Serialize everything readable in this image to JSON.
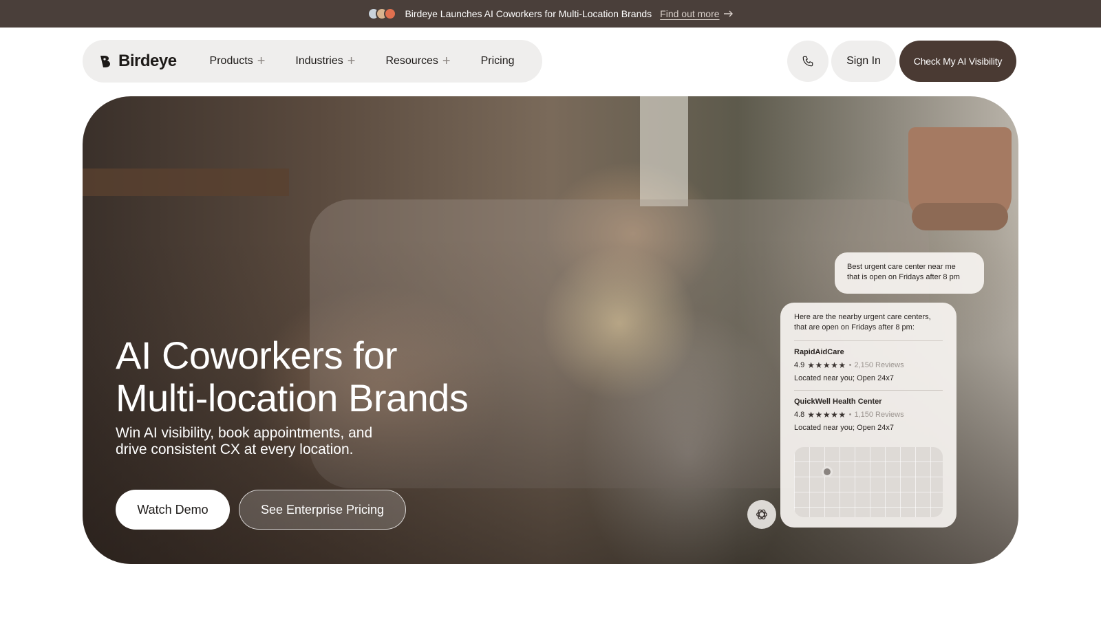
{
  "announcement": {
    "text": "Birdeye Launches AI Coworkers for Multi-Location Brands",
    "link_label": "Find out more"
  },
  "header": {
    "logo_text": "Birdeye",
    "nav": [
      {
        "label": "Products",
        "has_menu": true
      },
      {
        "label": "Industries",
        "has_menu": true
      },
      {
        "label": "Resources",
        "has_menu": true
      },
      {
        "label": "Pricing",
        "has_menu": false
      }
    ],
    "signin_label": "Sign In",
    "cta_label": "Check My AI Visibility"
  },
  "hero": {
    "title_line1": "AI Coworkers for",
    "title_line2": "Multi-location Brands",
    "subtitle_line1": "Win AI visibility, book appointments, and",
    "subtitle_line2": "drive consistent CX at every location.",
    "primary_button": "Watch Demo",
    "secondary_button": "See Enterprise Pricing"
  },
  "chat": {
    "query_line1": "Best urgent care center near me",
    "query_line2": "that is open on Fridays after 8 pm",
    "answer_intro_line1": "Here are the nearby urgent care centers,",
    "answer_intro_line2": "that are open on Fridays after 8 pm:",
    "results": [
      {
        "name": "RapidAidCare",
        "rating": "4.9",
        "stars": "★★★★★",
        "reviews": "2,150 Reviews",
        "location": "Located near you; Open 24x7"
      },
      {
        "name": "QuickWell Health Center",
        "rating": "4.8",
        "stars": "★★★★★",
        "reviews": "1,150 Reviews",
        "location": "Located near you; Open 24x7"
      }
    ],
    "separator": "•"
  },
  "colors": {
    "announcement_bg": "#4a3f3a",
    "cta_bg": "#4a3a33",
    "nav_pill_bg": "#efeeed"
  },
  "icons": [
    "plus-icon",
    "arrow-right-icon",
    "phone-icon",
    "star-icon",
    "map-pin-icon",
    "ai-assistant-icon",
    "birdeye-logo-icon"
  ]
}
